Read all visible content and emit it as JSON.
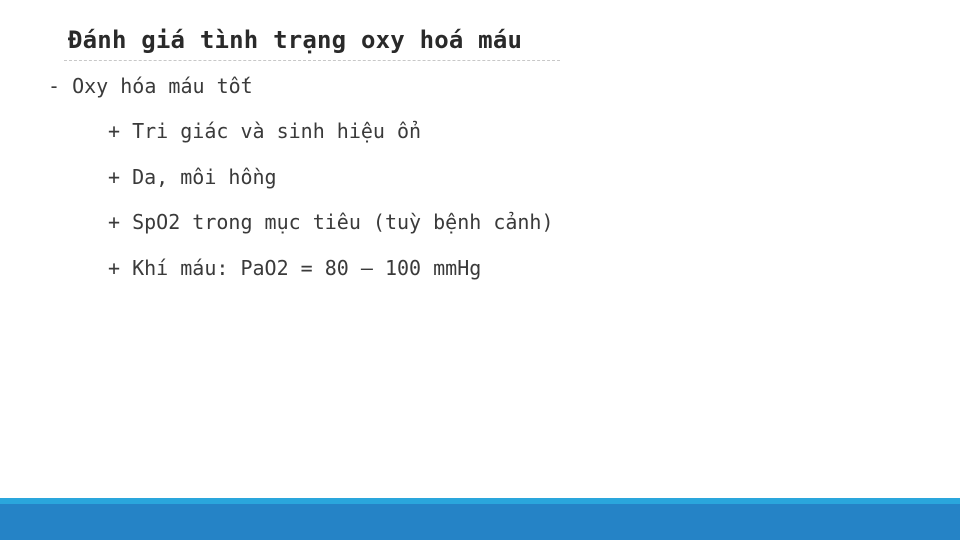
{
  "slide": {
    "title": "Đánh giá tình trạng oxy hoá máu",
    "bullets": [
      "- Oxy hóa máu tốt",
      "+ Tri giác và sinh hiệu ổn",
      "+ Da, môi hồng",
      "+ SpO2 trong mục tiêu (tuỳ bệnh cảnh)",
      "+ Khí máu: PaO2 = 80 – 100 mmHg"
    ]
  },
  "colors": {
    "footer_accent": "#2aa6dc",
    "footer_bar": "#2583c6",
    "text": "#3a3a3a"
  }
}
